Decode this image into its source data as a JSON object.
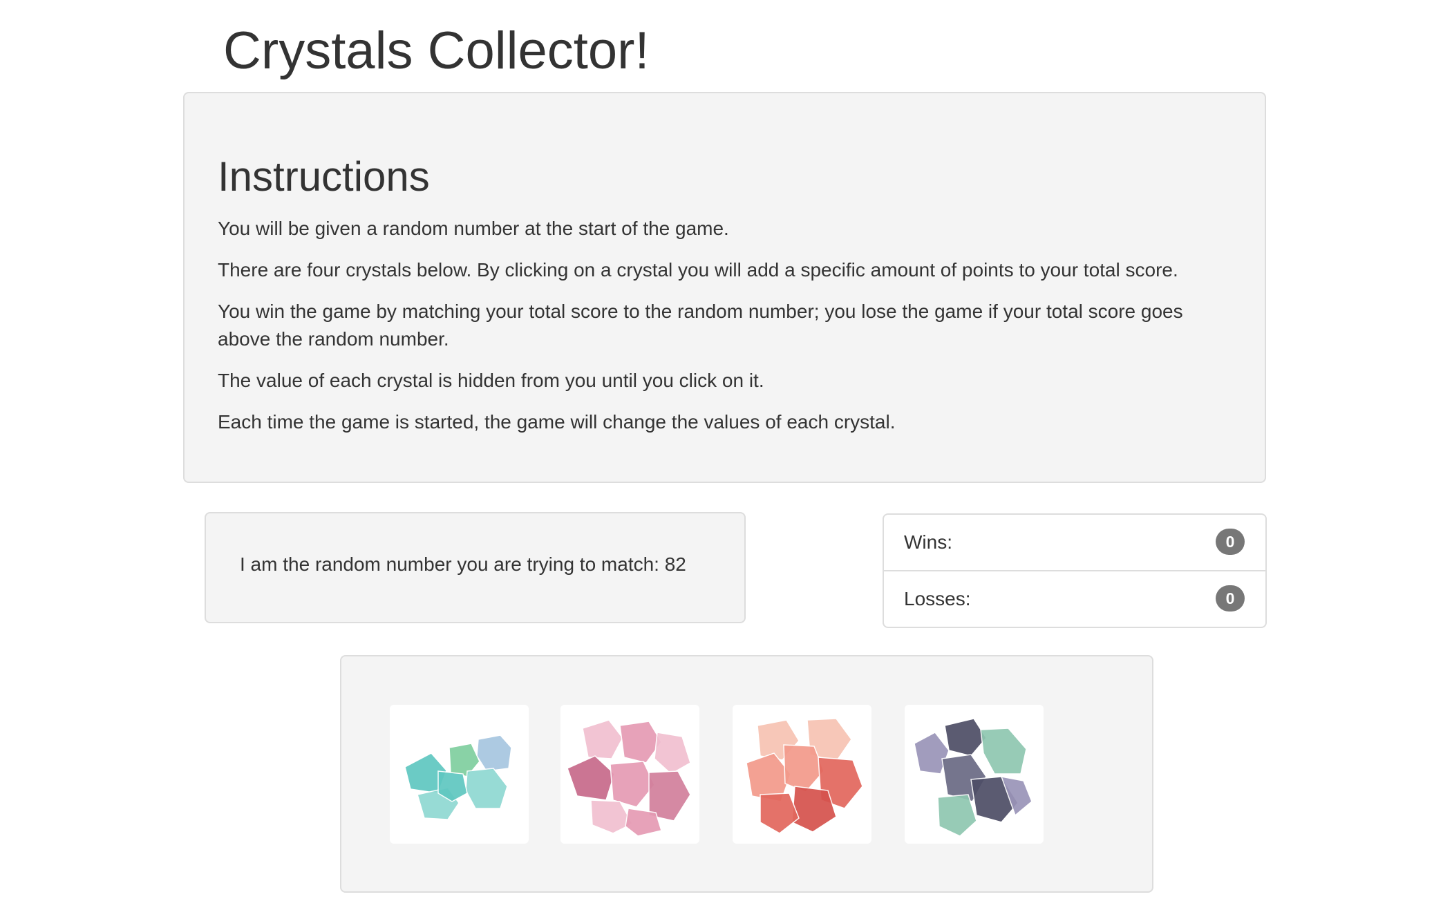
{
  "header": {
    "title": "Crystals Collector!"
  },
  "instructions": {
    "heading": "Instructions",
    "lines": [
      "You will be given a random number at the start of the game.",
      "There are four crystals below. By clicking on a crystal you will add a specific amount of points to your total score.",
      "You win the game by matching your total score to the random number; you lose the game if your total score goes above the random number.",
      "The value of each crystal is hidden from you until you click on it.",
      "Each time the game is started, the game will change the values of each crystal."
    ]
  },
  "random_number": {
    "text": "I am the random number you are trying to match: 82"
  },
  "scoreboard": {
    "wins_label": "Wins:",
    "wins_value": "0",
    "losses_label": "Losses:",
    "losses_value": "0",
    "badge_color": "#777777"
  },
  "crystals": [
    {
      "icon": "teal-fluorite-crystal-icon",
      "colors": [
        "#5fc7c0",
        "#8fd8d2",
        "#a7c6e0",
        "#7fcf9f"
      ]
    },
    {
      "icon": "pink-rose-quartz-crystal-icon",
      "colors": [
        "#e59bb4",
        "#d27f9c",
        "#f1bfd0",
        "#c76a8a"
      ]
    },
    {
      "icon": "peach-strawberry-quartz-crystal-icon",
      "colors": [
        "#f29a8a",
        "#e2675d",
        "#f7c3b3",
        "#d5524d"
      ]
    },
    {
      "icon": "purple-fluorite-crystal-icon",
      "colors": [
        "#6a6a84",
        "#8fc7b0",
        "#9a94b8",
        "#4e4e66"
      ]
    }
  ]
}
